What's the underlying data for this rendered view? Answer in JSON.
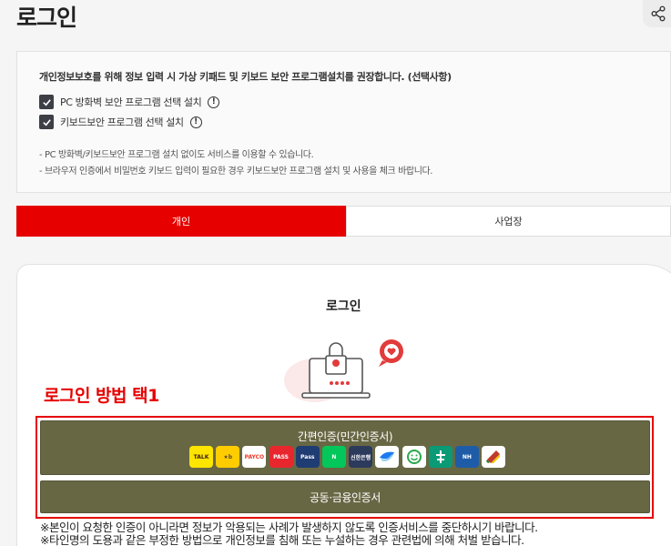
{
  "page": {
    "title": "로그인"
  },
  "notice": {
    "title": "개인정보보호를 위해 정보 입력 시 가상 키패드 및 키보드 보안 프로그램설치를 권장합니다. (선택사항)",
    "options": [
      {
        "label": "PC 방화벽 보안 프로그램 선택 설치",
        "checked": true
      },
      {
        "label": "키보드보안 프로그램 선택 설치",
        "checked": true
      }
    ],
    "notes": [
      "- PC 방화벽/키보드보안 프로그램 설치 없이도 서비스를 이용할 수 있습니다.",
      "- 브라우저 인증에서 비밀번호 키보드 입력이 필요한 경우 키보드보안 프로그램 설치 및 사용을 체크 바랍니다."
    ]
  },
  "tabs": [
    {
      "label": "개인",
      "active": true
    },
    {
      "label": "사업장",
      "active": false
    }
  ],
  "login": {
    "title": "로그인",
    "annotation": "로그인 방법 택1",
    "simple_auth_label": "간편인증(민간인증서)",
    "providers": [
      {
        "name": "kakao",
        "text": "TALK",
        "bg": "#fee500",
        "fg": "#3a1d1d"
      },
      {
        "name": "kb",
        "text": "★b",
        "bg": "#ffcc00",
        "fg": "#5a4a2a"
      },
      {
        "name": "payco",
        "text": "PAYCO",
        "bg": "#ffffff",
        "fg": "#f0392b"
      },
      {
        "name": "pass",
        "text": "PASS",
        "bg": "#e8262d",
        "fg": "#ffffff"
      },
      {
        "name": "samsung-pass",
        "text": "Pass",
        "bg": "#1f3c73",
        "fg": "#ffffff"
      },
      {
        "name": "naver",
        "text": "N",
        "bg": "#03c75a",
        "fg": "#ffffff"
      },
      {
        "name": "shinhan",
        "text": "신한은행",
        "bg": "#2c3a5c",
        "fg": "#ffffff"
      },
      {
        "name": "toss",
        "text": "",
        "bg": "#ffffff",
        "fg": "#0064ff"
      },
      {
        "name": "kica",
        "text": "",
        "bg": "#ffffff",
        "fg": "#2aa84a"
      },
      {
        "name": "hana",
        "text": "",
        "bg": "#0a9a76",
        "fg": "#ffffff"
      },
      {
        "name": "nh",
        "text": "NH",
        "bg": "#1e5ca8",
        "fg": "#ffffff"
      },
      {
        "name": "bank",
        "text": "",
        "bg": "#ffffff",
        "fg": "#c0392b"
      }
    ],
    "cert_label": "공동·금융인증서",
    "warnings": [
      "※본인이 요청한 인증이 아니라면 정보가 악용되는 사례가 발생하지 않도록 인증서비스를 중단하시기 바랍니다.",
      "※타인명의 도용과 같은 부정한 방법으로 개인정보를 침해 또는 누설하는 경우 관련법에 의해 처벌 받습니다."
    ]
  },
  "colors": {
    "accent": "#e60000",
    "button": "#686744"
  }
}
